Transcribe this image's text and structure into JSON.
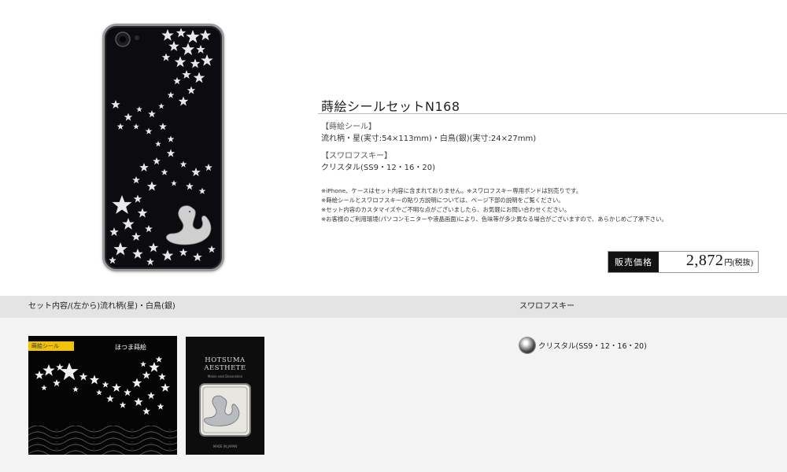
{
  "product": {
    "title": "蒔絵シールセットN168",
    "spec1_heading": "【蒔絵シール】",
    "spec1_body": "流れ柄・星(実寸:54×113mm)・白鳥(銀)(実寸:24×27mm)",
    "spec2_heading": "【スワロフスキー】",
    "spec2_body": "クリスタル(SS9・12・16・20)",
    "notes": [
      "※iPhone、ケースはセット内容に含まれておりません。※スワロフスキー専用ボンドは別売りです。",
      "※蒔絵シールとスワロフスキーの貼り方説明については、ページ下部の説明をご覧ください。",
      "※セット内容のカスタマイズやご不明な点がございましたら、お気軽にお問い合わせください。",
      "※お客様のご利用環境(パソコンモニターや液晶画面)により、色味等が多少異なる場合がございますので、あらかじめご了承下さい。"
    ],
    "price_label": "販売価格",
    "price": "2,872",
    "price_unit": "円(税抜)"
  },
  "set_contents": {
    "heading": "セット内容/(左から)流れ柄(星)・白鳥(銀)",
    "package1_tag": "蒔絵シール",
    "package1_brand": "ほつま蒔絵",
    "package2_title": "HOTSUMA AESTHETE",
    "package2_subtitle": "Makie seal Decoration",
    "package2_footer": "MADE IN JAPAN"
  },
  "swarovski": {
    "heading": "スワロフスキー",
    "item_label": "クリスタル(SS9・12・16・20)"
  },
  "colors": {
    "band": "#e4e4e4",
    "lower_bg": "#f3f3f3",
    "price_label_bg": "#111111",
    "package_tag": "#f2c200"
  }
}
